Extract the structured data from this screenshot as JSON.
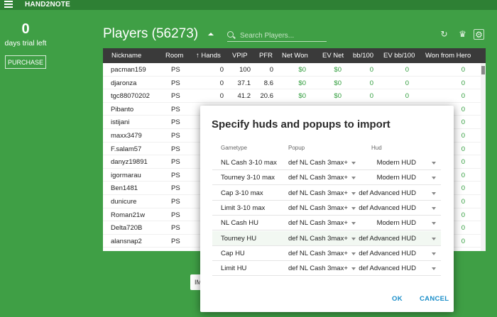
{
  "app": {
    "title": "HAND2NOTE"
  },
  "trial": {
    "days": "0",
    "label": "days trial left",
    "purchase": "PURCHASE"
  },
  "players": {
    "title": "Players (56273)",
    "search_placeholder": "Search Players..."
  },
  "icons": {
    "menu": "menu-icon",
    "refresh": "refresh-icon",
    "trophy": "trophy-icon",
    "settings": "gear-icon"
  },
  "colors": {
    "background": "#3f9f45",
    "topbar": "#2e8034",
    "table_header": "#3a3a3a",
    "positive": "#2e9c3a",
    "dialog_button": "#1a8ec9"
  },
  "table": {
    "columns": [
      "Nickname",
      "Room",
      "↑ Hands",
      "VPIP",
      "PFR",
      "Net Won",
      "EV Net",
      "bb/100",
      "EV bb/100",
      "Won from Hero"
    ],
    "rows": [
      {
        "nick": "pacman159",
        "room": "PS",
        "hands": "0",
        "vpip": "100",
        "pfr": "0",
        "net": "$0",
        "ev": "$0",
        "bb": "0",
        "evbb": "0",
        "hero": "0"
      },
      {
        "nick": "djaronza",
        "room": "PS",
        "hands": "0",
        "vpip": "37.1",
        "pfr": "8.6",
        "net": "$0",
        "ev": "$0",
        "bb": "0",
        "evbb": "0",
        "hero": "0"
      },
      {
        "nick": "tgc88070202",
        "room": "PS",
        "hands": "0",
        "vpip": "41.2",
        "pfr": "20.6",
        "net": "$0",
        "ev": "$0",
        "bb": "0",
        "evbb": "0",
        "hero": "0"
      },
      {
        "nick": "Pibanto",
        "room": "PS",
        "hero": "0"
      },
      {
        "nick": "istijani",
        "room": "PS",
        "hero": "0"
      },
      {
        "nick": "maxx3479",
        "room": "PS",
        "hero": "0"
      },
      {
        "nick": "F.salam57",
        "room": "PS",
        "hero": "0"
      },
      {
        "nick": "danyz19891",
        "room": "PS",
        "hero": "0"
      },
      {
        "nick": "igormarau",
        "room": "PS",
        "hero": "0"
      },
      {
        "nick": "Ben1481",
        "room": "PS",
        "hero": "0"
      },
      {
        "nick": "dunicure",
        "room": "PS",
        "hero": "0"
      },
      {
        "nick": "Roman21w",
        "room": "PS",
        "hero": "0"
      },
      {
        "nick": "Delta720B",
        "room": "PS",
        "hero": "0"
      },
      {
        "nick": "alansnap2",
        "room": "PS",
        "hero": "0"
      }
    ]
  },
  "behind_button": {
    "label": "IM"
  },
  "dialog": {
    "title": "Specify huds and popups to import",
    "headers": {
      "gametype": "Gametype",
      "popup": "Popup",
      "hud": "Hud"
    },
    "rows": [
      {
        "gametype": "NL Cash 3-10 max",
        "popup": "def NL Cash 3max+",
        "hud": "Modern HUD"
      },
      {
        "gametype": "Tourney 3-10 max",
        "popup": "def NL Cash 3max+",
        "hud": "Modern HUD"
      },
      {
        "gametype": "Cap 3-10 max",
        "popup": "def NL Cash 3max+",
        "hud": "def Advanced HUD"
      },
      {
        "gametype": "Limit 3-10 max",
        "popup": "def NL Cash 3max+",
        "hud": "def Advanced HUD"
      },
      {
        "gametype": "NL Cash HU",
        "popup": "def NL Cash 3max+",
        "hud": "Modern HUD"
      },
      {
        "gametype": "Tourney HU",
        "popup": "def NL Cash 3max+",
        "hud": "def Advanced HUD"
      },
      {
        "gametype": "Cap HU",
        "popup": "def NL Cash 3max+",
        "hud": "def Advanced HUD"
      },
      {
        "gametype": "Limit HU",
        "popup": "def NL Cash 3max+",
        "hud": "def Advanced HUD"
      }
    ],
    "ok": "OK",
    "cancel": "CANCEL"
  }
}
